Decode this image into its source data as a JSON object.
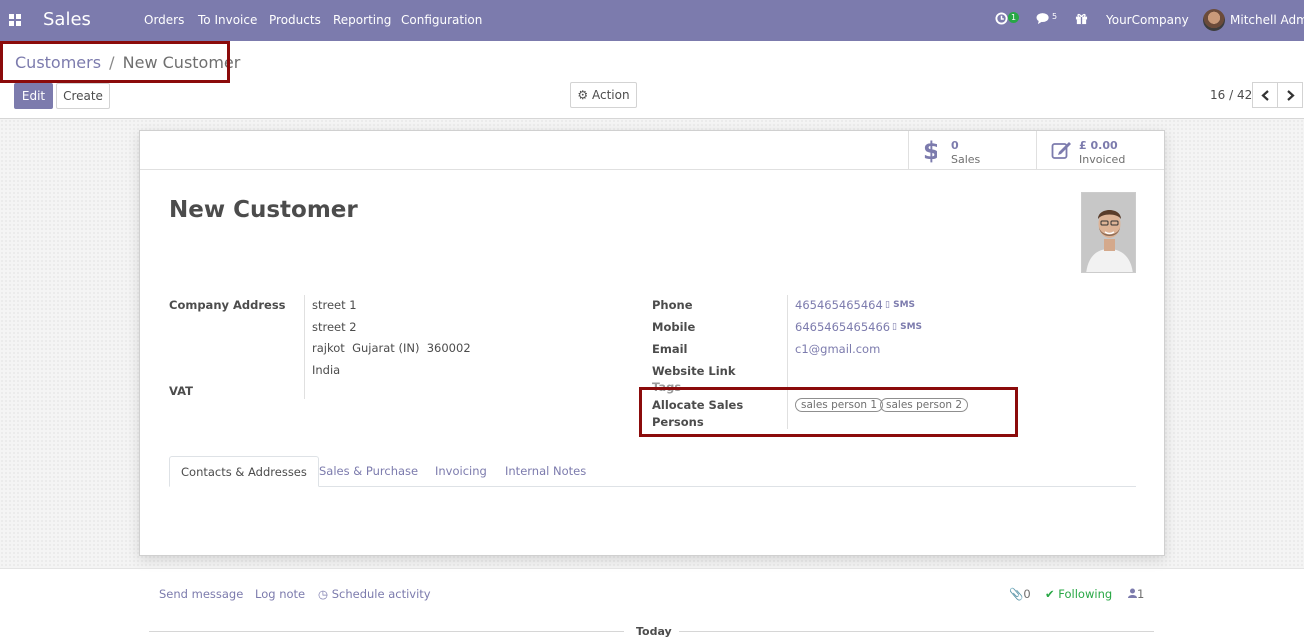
{
  "navbar": {
    "app_name": "Sales",
    "menu": [
      "Orders",
      "To Invoice",
      "Products",
      "Reporting",
      "Configuration"
    ],
    "activity_count": "1",
    "messages_count": "5",
    "company": "YourCompany",
    "user": "Mitchell Admin"
  },
  "breadcrumb": {
    "parent": "Customers",
    "separator": "/",
    "current": "New Customer"
  },
  "toolbar": {
    "edit_label": "Edit",
    "create_label": "Create",
    "action_label": "Action"
  },
  "pager": {
    "value": "16 / 42"
  },
  "stat_buttons": [
    {
      "value": "0",
      "label": "Sales",
      "icon": "dollar-icon"
    },
    {
      "value": "£ 0.00",
      "label": "Invoiced",
      "icon": "pencil-square-icon"
    }
  ],
  "record": {
    "name": "New Customer",
    "company_address_label": "Company Address",
    "address": {
      "street": "street 1",
      "street2": "street 2",
      "city_line": "rajkot  Gujarat (IN)  360002",
      "country": "India"
    },
    "vat_label": "VAT",
    "phone_label": "Phone",
    "phone": "465465465464",
    "mobile_label": "Mobile",
    "mobile": "6465465465466",
    "sms_label": "SMS",
    "email_label": "Email",
    "email": "c1@gmail.com",
    "website_label": "Website Link",
    "tags_label": "Tags",
    "sales_persons_label": "Allocate Sales Persons",
    "sales_persons_label_line1": "Allocate Sales",
    "sales_persons_label_line2": "Persons",
    "sales_persons": [
      "sales person 1",
      "sales person 2"
    ]
  },
  "tabs": [
    "Contacts & Addresses",
    "Sales & Purchase",
    "Invoicing",
    "Internal Notes"
  ],
  "chatter": {
    "send_message": "Send message",
    "log_note": "Log note",
    "schedule_activity": "Schedule activity",
    "attachments_count": "0",
    "following": "Following",
    "followers_count": "1",
    "today": "Today"
  },
  "colors": {
    "navbar": "#7c7bad",
    "accent": "#7c7bad",
    "highlight_box": "#8b0b0b",
    "following": "#28a745"
  }
}
